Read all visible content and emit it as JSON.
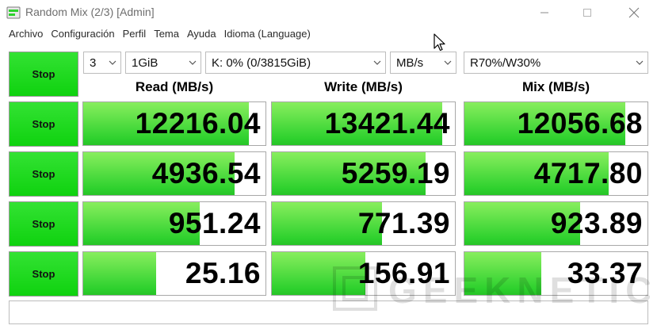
{
  "window": {
    "title": "Random Mix (2/3) [Admin]"
  },
  "menu": [
    "Archivo",
    "Configuración",
    "Perfil",
    "Tema",
    "Ayuda",
    "Idioma (Language)"
  ],
  "settings": {
    "count": "3",
    "size": "1GiB",
    "drive": "K: 0% (0/3815GiB)",
    "unit": "MB/s",
    "mix": "R70%/W30%"
  },
  "headers": {
    "read": "Read (MB/s)",
    "write": "Write (MB/s)",
    "mix": "Mix (MB/s)"
  },
  "all_button": "Stop",
  "rows": [
    {
      "button": "Stop",
      "read": "12216.04",
      "write": "13421.44",
      "mix": "12056.68",
      "read_fill": 0.91,
      "write_fill": 0.93,
      "mix_fill": 0.88
    },
    {
      "button": "Stop",
      "read": "4936.54",
      "write": "5259.19",
      "mix": "4717.80",
      "read_fill": 0.83,
      "write_fill": 0.84,
      "mix_fill": 0.79
    },
    {
      "button": "Stop",
      "read": "951.24",
      "write": "771.39",
      "mix": "923.89",
      "read_fill": 0.64,
      "write_fill": 0.6,
      "mix_fill": 0.63
    },
    {
      "button": "Stop",
      "read": "25.16",
      "write": "156.91",
      "mix": "33.37",
      "read_fill": 0.4,
      "write_fill": 0.51,
      "mix_fill": 0.42
    }
  ],
  "watermark": "GEEKNETIC",
  "colors": {
    "bar_light": "#88ee5e",
    "bar_dark": "#2ed12e",
    "button_green": "#1ad81a"
  }
}
